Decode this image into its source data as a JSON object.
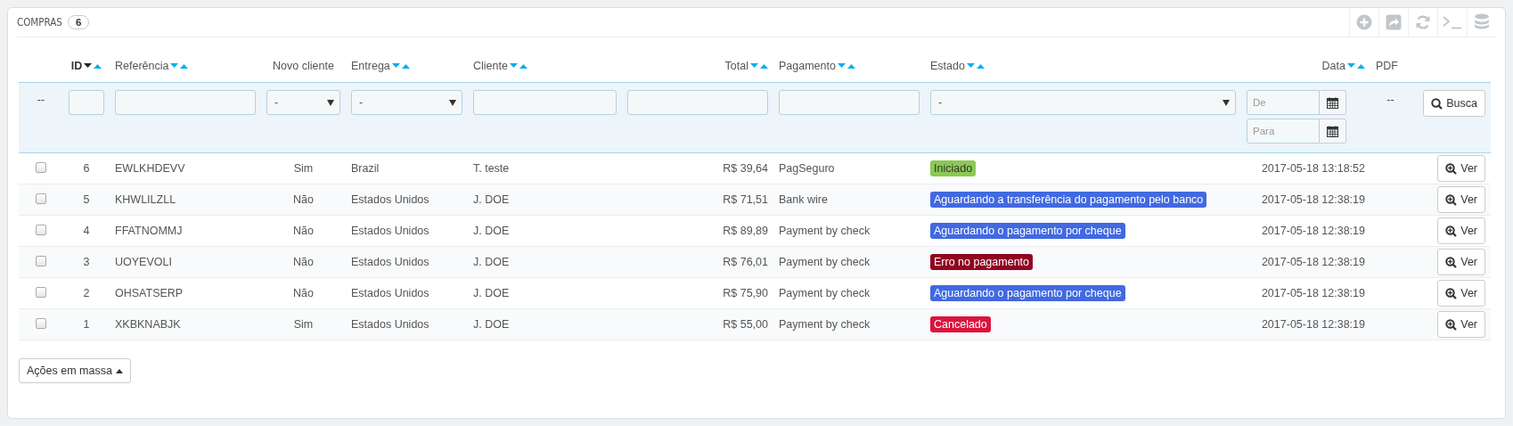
{
  "panel": {
    "title": "COMPRAS",
    "count": "6",
    "toolbar": [
      {
        "kind": "add"
      },
      {
        "kind": "export"
      },
      {
        "kind": "refresh"
      },
      {
        "kind": "terminal"
      },
      {
        "kind": "database"
      }
    ]
  },
  "columns": [
    {
      "label": "ID",
      "sortable": true,
      "sorted_descending": true
    },
    {
      "label": "Referência",
      "sortable": true,
      "sorted_descending": false
    },
    {
      "label": "Novo cliente",
      "sortable": false
    },
    {
      "label": "Entrega",
      "sortable": true,
      "sorted_descending": false
    },
    {
      "label": "Cliente",
      "sortable": true,
      "sorted_descending": false
    },
    {
      "label": "Total",
      "sortable": true,
      "sorted_descending": false
    },
    {
      "label": "Pagamento",
      "sortable": true,
      "sorted_descending": false
    },
    {
      "label": "Estado",
      "sortable": true,
      "sorted_descending": false
    },
    {
      "label": "Data",
      "sortable": true,
      "sorted_descending": false
    },
    {
      "label": "PDF",
      "sortable": false
    }
  ],
  "filters": [
    {
      "kind": "dash",
      "text": "--"
    },
    {
      "kind": "text"
    },
    {
      "kind": "text"
    },
    {
      "kind": "select",
      "value": "-"
    },
    {
      "kind": "select",
      "value": "-"
    },
    {
      "kind": "text"
    },
    {
      "kind": "text"
    },
    {
      "kind": "text"
    },
    {
      "kind": "select",
      "value": "-"
    },
    {
      "kind": "date",
      "placeholders": [
        "De",
        "Para"
      ]
    },
    {
      "kind": "dash",
      "text": "--"
    },
    {
      "kind": "button",
      "label": "Busca"
    }
  ],
  "rows": [
    {
      "checked": false,
      "cells": [
        "6",
        "EWLKHDEVV",
        "Sim",
        "Brazil",
        "T. teste",
        "R$ 39,64",
        "PagSeguro"
      ],
      "status": {
        "label": "Iniciado",
        "color": "#8bc954"
      },
      "date": "2017-05-18 13:18:52",
      "action": "Ver"
    },
    {
      "checked": false,
      "cells": [
        "5",
        "KHWLILZLL",
        "Não",
        "Estados Unidos",
        "J. DOE",
        "R$ 71,51",
        "Bank wire"
      ],
      "status": {
        "label": "Aguardando a transferência do pagamento pelo banco",
        "color": "#4169e1"
      },
      "date": "2017-05-18 12:38:19",
      "action": "Ver"
    },
    {
      "checked": false,
      "cells": [
        "4",
        "FFATNOMMJ",
        "Não",
        "Estados Unidos",
        "J. DOE",
        "R$ 89,89",
        "Payment by check"
      ],
      "status": {
        "label": "Aguardando o pagamento por cheque",
        "color": "#4169e1"
      },
      "date": "2017-05-18 12:38:19",
      "action": "Ver"
    },
    {
      "checked": false,
      "cells": [
        "3",
        "UOYEVOLI",
        "Não",
        "Estados Unidos",
        "J. DOE",
        "R$ 76,01",
        "Payment by check"
      ],
      "status": {
        "label": "Erro no pagamento",
        "color": "#8f0621"
      },
      "date": "2017-05-18 12:38:19",
      "action": "Ver"
    },
    {
      "checked": false,
      "cells": [
        "2",
        "OHSATSERP",
        "Não",
        "Estados Unidos",
        "J. DOE",
        "R$ 75,90",
        "Payment by check"
      ],
      "status": {
        "label": "Aguardando o pagamento por cheque",
        "color": "#4169e1"
      },
      "date": "2017-05-18 12:38:19",
      "action": "Ver"
    },
    {
      "checked": false,
      "cells": [
        "1",
        "XKBKNABJK",
        "Sim",
        "Estados Unidos",
        "J. DOE",
        "R$ 55,00",
        "Payment by check"
      ],
      "status": {
        "label": "Cancelado",
        "color": "#dc143c"
      },
      "date": "2017-05-18 12:38:19",
      "action": "Ver"
    }
  ],
  "bulk": {
    "label": "Ações em massa"
  }
}
